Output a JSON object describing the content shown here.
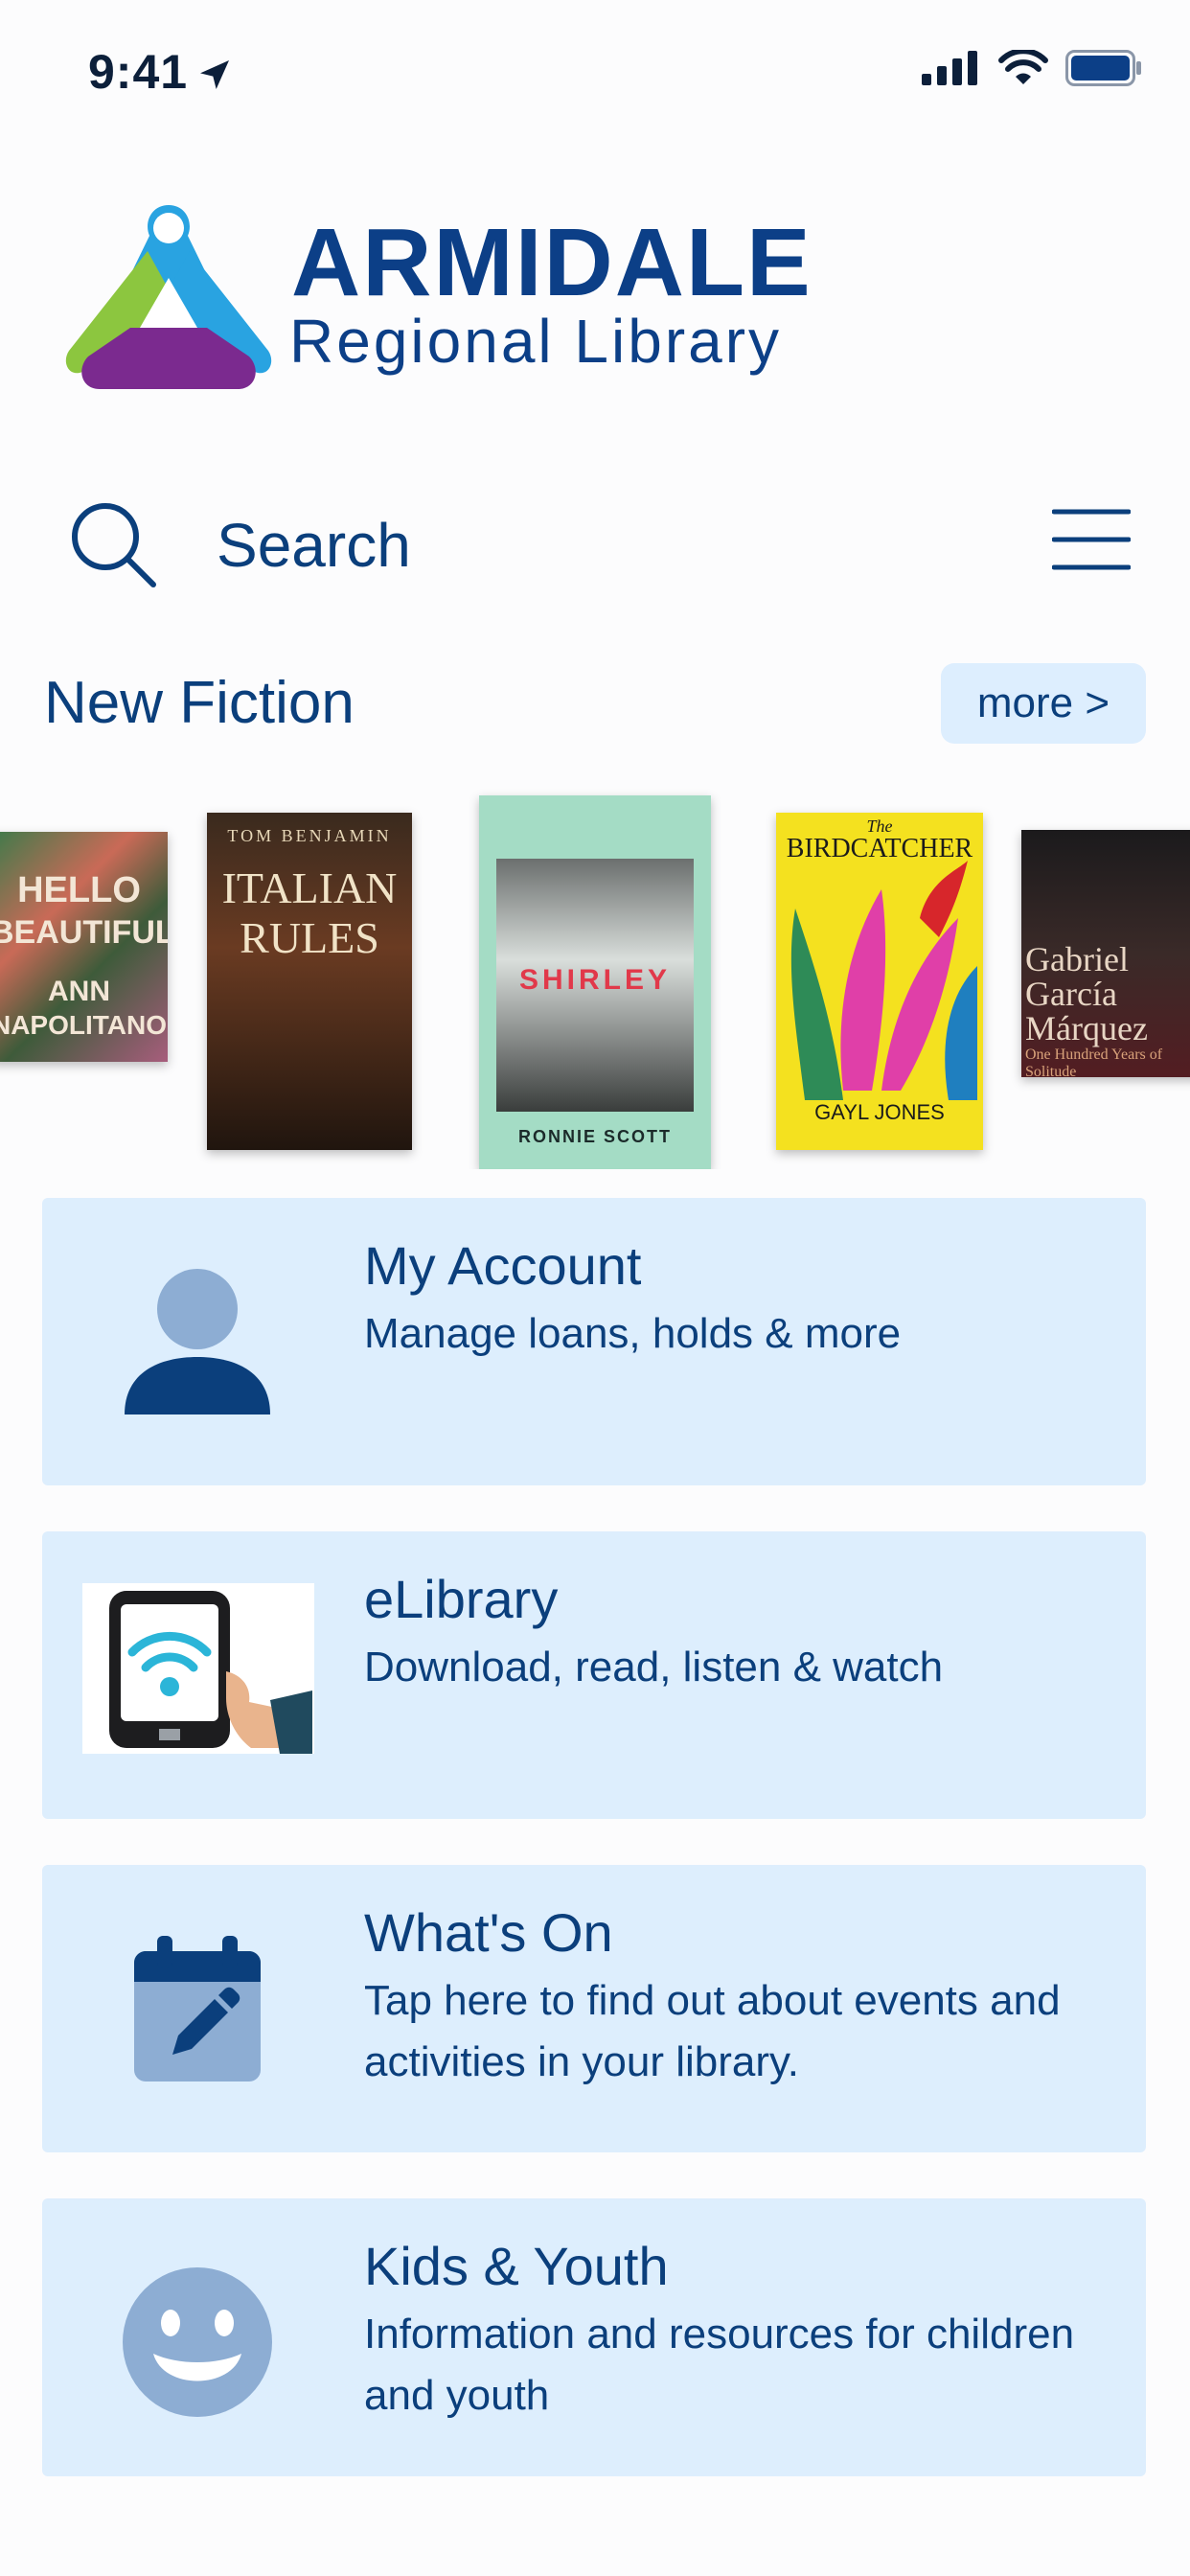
{
  "status_bar": {
    "time": "9:41"
  },
  "logo": {
    "title": "ARMIDALE",
    "subtitle": "Regional Library"
  },
  "search": {
    "label": "Search"
  },
  "new_fiction": {
    "title": "New Fiction",
    "more_label": "more >",
    "books": [
      {
        "cover_lines": [
          "HELLO",
          "BEAUTIFUL",
          "ANN",
          "NAPOLITANO"
        ]
      },
      {
        "cover_lines": [
          "TOM BENJAMIN",
          "ITALIAN",
          "RULES"
        ]
      },
      {
        "cover_lines": [
          "SHIRLEY",
          "RONNIE SCOTT"
        ]
      },
      {
        "cover_lines": [
          "The",
          "BIRDCATCHER",
          "GAYL JONES"
        ]
      },
      {
        "cover_lines": [
          "Gabriel",
          "García",
          "Márquez",
          "One Hundred Years of Solitude"
        ]
      }
    ]
  },
  "cards": [
    {
      "title": "My Account",
      "description": "Manage loans, holds & more",
      "icon": "person-icon"
    },
    {
      "title": "eLibrary",
      "description": "Download, read, listen & watch",
      "icon": "tablet-wifi-icon"
    },
    {
      "title": "What's On",
      "description": "Tap here to find out about events and activities in your library.",
      "icon": "calendar-edit-icon"
    },
    {
      "title": "Kids & Youth",
      "description": "Information and resources for children and youth",
      "icon": "smiley-icon"
    }
  ],
  "colors": {
    "brand_navy": "#0b3f7c",
    "card_bg": "#ddeefd",
    "logo_green": "#8cc63f",
    "logo_blue": "#29a3e1",
    "logo_purple": "#7b2a8f"
  }
}
